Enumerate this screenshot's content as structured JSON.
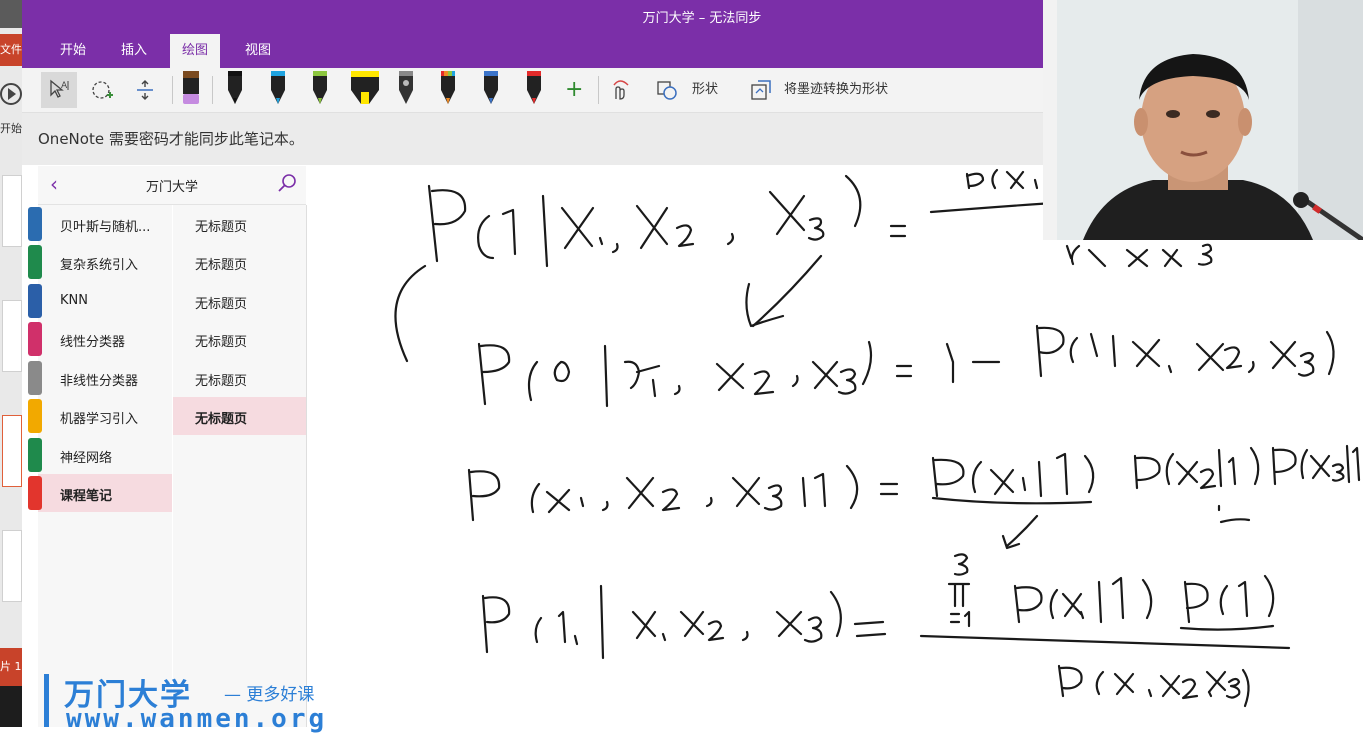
{
  "window": {
    "title": "万门大学 – 无法同步"
  },
  "menu": {
    "tabs": [
      "开始",
      "插入",
      "绘图",
      "视图"
    ],
    "active": "绘图"
  },
  "ribbon": {
    "tools": [
      "lasso-select-icon",
      "eraser-icon",
      "insert-space-icon"
    ],
    "pens": [
      {
        "name": "purple-highlighter",
        "color": "#c58be0"
      },
      {
        "name": "black-pen",
        "color": "#111111"
      },
      {
        "name": "blue-pen",
        "color": "#1fa3e0"
      },
      {
        "name": "green-pen",
        "color": "#8cc63f"
      },
      {
        "name": "yellow-highlighter",
        "color": "#ffe600"
      },
      {
        "name": "galaxy-pen",
        "color": "#888888"
      },
      {
        "name": "rainbow-pen",
        "color": "#f08a24"
      },
      {
        "name": "blue-galaxy-pen",
        "color": "#3a73c9"
      },
      {
        "name": "red-pen",
        "color": "#e32a2a"
      }
    ],
    "add_pen": "+",
    "shapes_label": "形状",
    "ink_to_shape_label": "将墨迹转换为形状"
  },
  "notice": {
    "text": "OneNote 需要密码才能同步此笔记本。"
  },
  "notebook": {
    "title": "万门大学",
    "sections": [
      {
        "label": "贝叶斯与随机...",
        "color": "#2b6cb0"
      },
      {
        "label": "复杂系统引入",
        "color": "#1f8a4c"
      },
      {
        "label": "KNN",
        "color": "#2b5fa8"
      },
      {
        "label": "线性分类器",
        "color": "#d0306a"
      },
      {
        "label": "非线性分类器",
        "color": "#8a8a8a"
      },
      {
        "label": "机器学习引入",
        "color": "#f2a900"
      },
      {
        "label": "神经网络",
        "color": "#1f8a4c"
      },
      {
        "label": "课程笔记",
        "color": "#e2352d"
      }
    ],
    "active_section": 7,
    "pages": [
      "无标题页",
      "无标题页",
      "无标题页",
      "无标题页",
      "无标题页",
      "无标题页"
    ],
    "active_page": 5
  },
  "background_app": {
    "tab_label": "文件",
    "start_label": "开始",
    "bottom_label": "片 1"
  },
  "watermark": {
    "brand": "万门大学",
    "slogan": "— 更多好课",
    "url": "www.wanmen.org"
  }
}
